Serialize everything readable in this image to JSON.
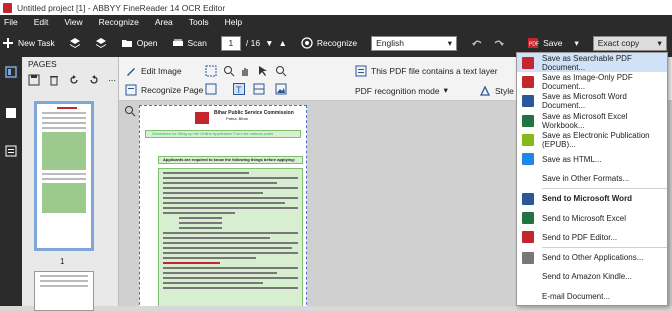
{
  "window": {
    "title": "Untitled project [1] - ABBYY FineReader 14 OCR Editor"
  },
  "menu": [
    "File",
    "Edit",
    "View",
    "Recognize",
    "Area",
    "Tools",
    "Help"
  ],
  "toolbar": {
    "new_task": "New Task",
    "open": "Open",
    "scan": "Scan",
    "page_current": "1",
    "page_total": "/ 16",
    "recognize": "Recognize",
    "language": "English",
    "save": "Save",
    "format": "Exact copy"
  },
  "pages_panel": {
    "title": "PAGES",
    "page_label": "1"
  },
  "image_tools": {
    "edit_image": "Edit Image",
    "recognize_page": "Recognize Page",
    "text_layer_notice": "This PDF file contains a text layer",
    "pdf_mode": "PDF recognition mode",
    "style": "Style"
  },
  "save_menu": [
    {
      "label": "Save as Searchable PDF Document...",
      "icon": "pdf-icon",
      "color": "#c3262e"
    },
    {
      "label": "Save as Image-Only PDF Document...",
      "icon": "pdf-icon",
      "color": "#c3262e"
    },
    {
      "label": "Save as Microsoft Word Document...",
      "icon": "word-icon",
      "color": "#2b579a"
    },
    {
      "label": "Save as Microsoft Excel Workbook...",
      "icon": "excel-icon",
      "color": "#217346"
    },
    {
      "label": "Save as Electronic Publication (EPUB)...",
      "icon": "epub-icon",
      "color": "#86b817"
    },
    {
      "label": "Save as HTML...",
      "icon": "html-icon",
      "color": "#1e88e5"
    },
    {
      "label": "Save in Other Formats...",
      "icon": "",
      "color": ""
    },
    {
      "label": "Send to Microsoft Word",
      "icon": "word-icon",
      "color": "#2b579a",
      "bold": true
    },
    {
      "label": "Send to Microsoft Excel",
      "icon": "excel-icon",
      "color": "#217346"
    },
    {
      "label": "Send to PDF Editor...",
      "icon": "pdf-icon",
      "color": "#c3262e"
    },
    {
      "label": "Send to Other Applications...",
      "icon": "apps-icon",
      "color": "#777777"
    },
    {
      "label": "Send to Amazon Kindle...",
      "icon": "",
      "color": ""
    },
    {
      "label": "E-mail Document...",
      "icon": "",
      "color": ""
    }
  ],
  "document": {
    "header_line1": "Bihar Public Service Commission",
    "header_line2": "Patna, Bihar",
    "header_link": "Guidelines for filling up the Online Application Form for various posts",
    "section_heading": "Applicants are required to know the following things before applying:"
  }
}
